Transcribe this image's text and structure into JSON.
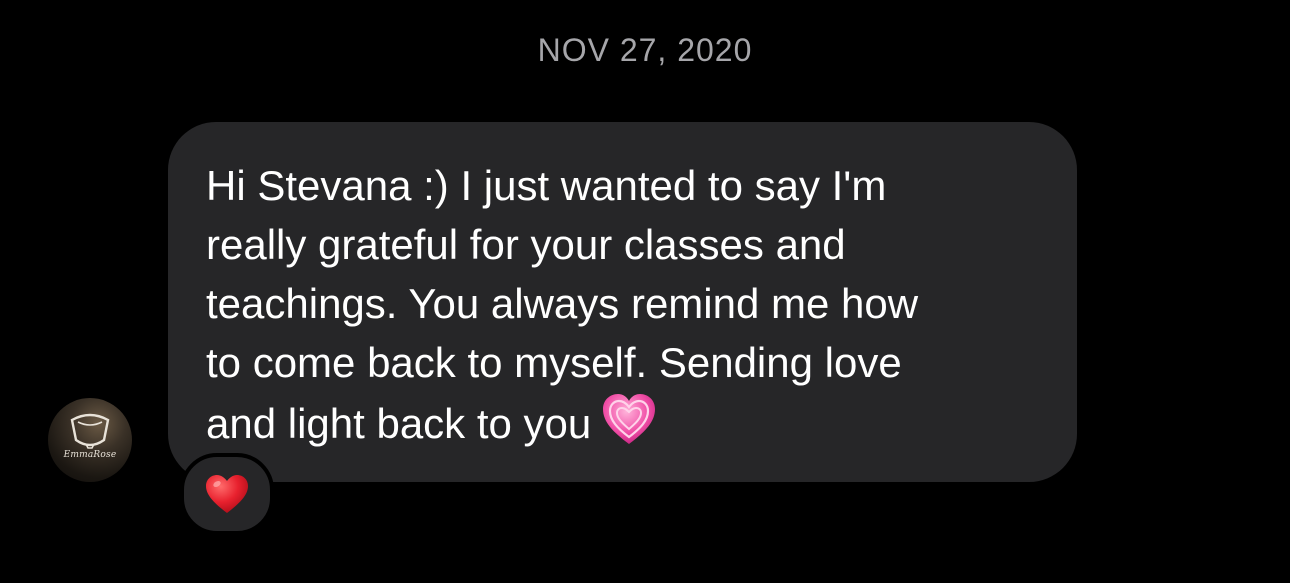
{
  "thread": {
    "date_label": "NOV 27, 2020"
  },
  "message": {
    "text": "Hi Stevana :) I just wanted to say I'm\nreally grateful for your classes and\nteachings. You always remind me how\nto come back to myself. Sending love\nand light back to you",
    "inline_emoji": "growing-heart-emoji",
    "sender_avatar": {
      "logo_text": "EmmaRose",
      "icon": "cup-logo-icon"
    }
  },
  "reaction": {
    "emoji": "red-heart-emoji",
    "color": "#e8212e"
  },
  "colors": {
    "background": "#000000",
    "bubble": "#262628",
    "date_text": "#a6a6aa",
    "message_text": "#ffffff",
    "heart_pink": "#f04ea6"
  }
}
